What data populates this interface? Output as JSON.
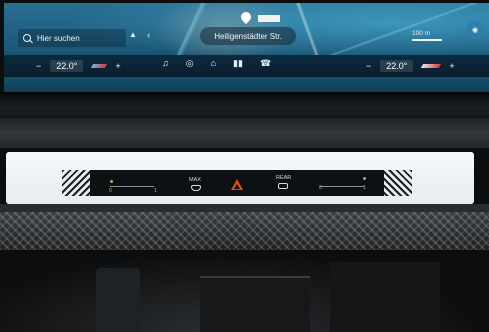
{
  "display": {
    "search_label": "Hier suchen",
    "street_name": "Heiligenstädter Str.",
    "scale_label": "100 m",
    "climate_left": {
      "temperature": "22.0°",
      "minus": "−",
      "plus": "+"
    },
    "climate_right": {
      "temperature": "22.0°",
      "minus": "−",
      "plus": "+"
    },
    "dock_icons": [
      "music-icon",
      "nav-icon",
      "home-icon",
      "apps-icon",
      "phone-icon"
    ]
  },
  "climate_panel": {
    "left_slider": {
      "min_label": "0",
      "max_label": "1"
    },
    "right_slider": {
      "min_label": "0",
      "max_label": "1"
    },
    "defrost_max_label": "MAX",
    "defrost_rear_label": "REAR"
  },
  "colors": {
    "hazard": "#e24a1e",
    "indicator_green": "#6ad14c",
    "display_blue": "#1e6f90"
  }
}
